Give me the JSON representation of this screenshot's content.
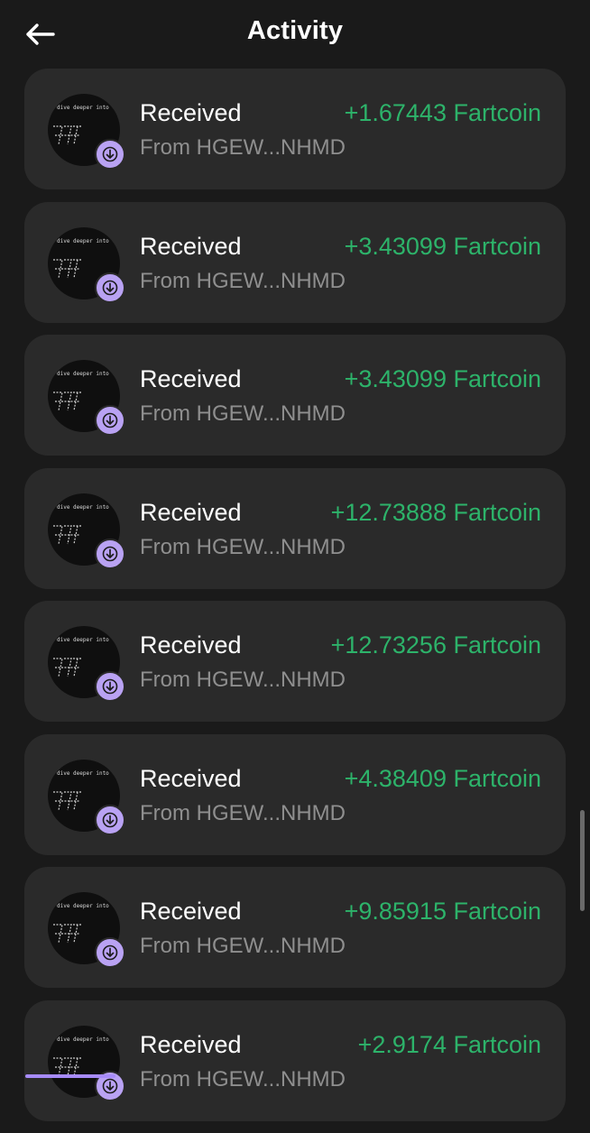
{
  "header": {
    "title": "Activity",
    "back_icon": "arrow-left-icon"
  },
  "avatar": {
    "caption": "dive deeper into this",
    "badge_icon": "arrow-down-icon"
  },
  "colors": {
    "background": "#1a1a1a",
    "card": "#2a2a2a",
    "amount": "#2db36a",
    "badge": "#b9a2f3",
    "secondary_text": "#8f8f8f"
  },
  "transactions": [
    {
      "label": "Received",
      "from": "From HGEW...NHMD",
      "amount": "+1.67443 Fartcoin"
    },
    {
      "label": "Received",
      "from": "From HGEW...NHMD",
      "amount": "+3.43099 Fartcoin"
    },
    {
      "label": "Received",
      "from": "From HGEW...NHMD",
      "amount": "+3.43099 Fartcoin"
    },
    {
      "label": "Received",
      "from": "From HGEW...NHMD",
      "amount": "+12.73888 Fartcoin"
    },
    {
      "label": "Received",
      "from": "From HGEW...NHMD",
      "amount": "+12.73256 Fartcoin"
    },
    {
      "label": "Received",
      "from": "From HGEW...NHMD",
      "amount": "+4.38409 Fartcoin"
    },
    {
      "label": "Received",
      "from": "From HGEW...NHMD",
      "amount": "+9.85915 Fartcoin"
    },
    {
      "label": "Received",
      "from": "From HGEW...NHMD",
      "amount": "+2.9174 Fartcoin"
    }
  ]
}
